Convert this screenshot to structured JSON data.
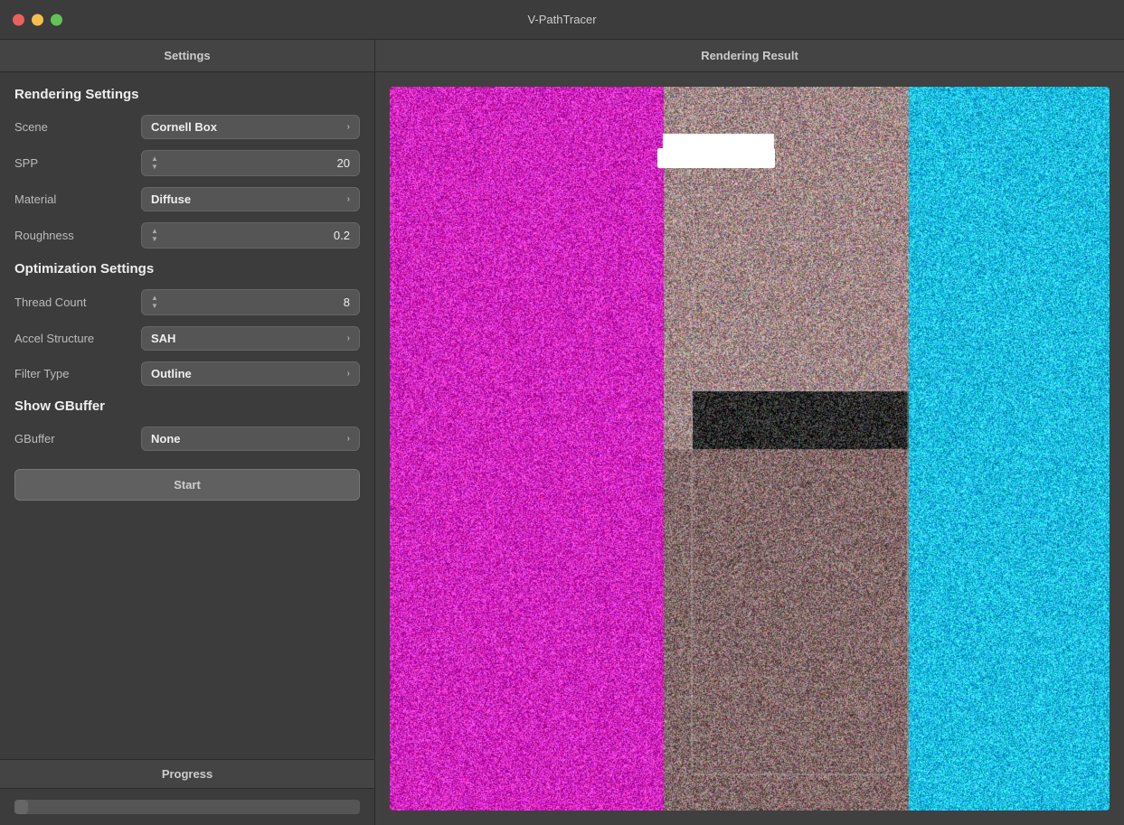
{
  "window": {
    "title": "V-PathTracer"
  },
  "window_controls": {
    "close_label": "",
    "minimize_label": "",
    "maximize_label": ""
  },
  "left_panel": {
    "header": "Settings",
    "rendering_section": {
      "title": "Rendering Settings",
      "fields": [
        {
          "label": "Scene",
          "type": "dropdown",
          "value": "Cornell Box"
        },
        {
          "label": "SPP",
          "type": "spinner",
          "value": "20"
        },
        {
          "label": "Material",
          "type": "dropdown",
          "value": "Diffuse"
        },
        {
          "label": "Roughness",
          "type": "spinner",
          "value": "0.2"
        }
      ]
    },
    "optimization_section": {
      "title": "Optimization Settings",
      "fields": [
        {
          "label": "Thread Count",
          "type": "spinner",
          "value": "8"
        },
        {
          "label": "Accel Structure",
          "type": "dropdown",
          "value": "SAH"
        },
        {
          "label": "Filter Type",
          "type": "dropdown",
          "value": "Outline"
        }
      ]
    },
    "gbuffer_section": {
      "title": "Show GBuffer",
      "fields": [
        {
          "label": "GBuffer",
          "type": "dropdown",
          "value": "None"
        }
      ]
    },
    "start_button": "Start"
  },
  "progress_section": {
    "header": "Progress",
    "value": 4
  },
  "right_panel": {
    "header": "Rendering Result"
  }
}
